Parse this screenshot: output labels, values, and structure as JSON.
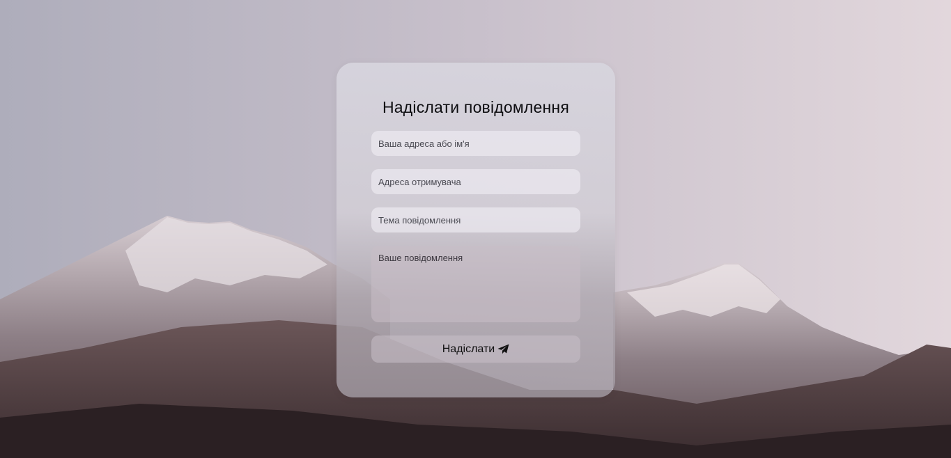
{
  "form": {
    "title": "Надіслати повідомлення",
    "sender_placeholder": "Ваша адреса або ім'я",
    "recipient_placeholder": "Адреса отримувача",
    "subject_placeholder": "Тема повідомлення",
    "message_placeholder": "Ваше повідомлення",
    "send_label": "Надіслати",
    "send_icon": "paper-plane-icon"
  },
  "colors": {
    "sky": "#c7c1cc",
    "mountain_dark": "#3d3134",
    "snow": "#d9d0d4"
  }
}
